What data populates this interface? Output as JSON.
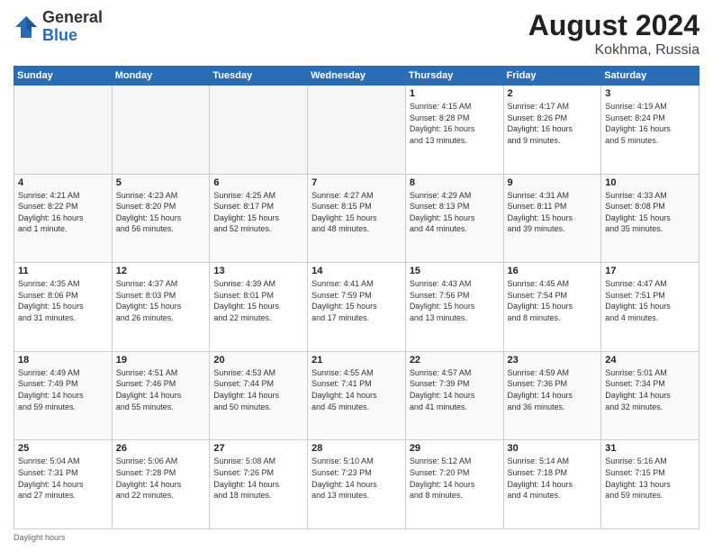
{
  "header": {
    "logo_general": "General",
    "logo_blue": "Blue",
    "month_year": "August 2024",
    "location": "Kokhma, Russia"
  },
  "footer": {
    "text": "Daylight hours"
  },
  "days_of_week": [
    "Sunday",
    "Monday",
    "Tuesday",
    "Wednesday",
    "Thursday",
    "Friday",
    "Saturday"
  ],
  "weeks": [
    [
      {
        "day": "",
        "info": ""
      },
      {
        "day": "",
        "info": ""
      },
      {
        "day": "",
        "info": ""
      },
      {
        "day": "",
        "info": ""
      },
      {
        "day": "1",
        "info": "Sunrise: 4:15 AM\nSunset: 8:28 PM\nDaylight: 16 hours\nand 13 minutes."
      },
      {
        "day": "2",
        "info": "Sunrise: 4:17 AM\nSunset: 8:26 PM\nDaylight: 16 hours\nand 9 minutes."
      },
      {
        "day": "3",
        "info": "Sunrise: 4:19 AM\nSunset: 8:24 PM\nDaylight: 16 hours\nand 5 minutes."
      }
    ],
    [
      {
        "day": "4",
        "info": "Sunrise: 4:21 AM\nSunset: 8:22 PM\nDaylight: 16 hours\nand 1 minute."
      },
      {
        "day": "5",
        "info": "Sunrise: 4:23 AM\nSunset: 8:20 PM\nDaylight: 15 hours\nand 56 minutes."
      },
      {
        "day": "6",
        "info": "Sunrise: 4:25 AM\nSunset: 8:17 PM\nDaylight: 15 hours\nand 52 minutes."
      },
      {
        "day": "7",
        "info": "Sunrise: 4:27 AM\nSunset: 8:15 PM\nDaylight: 15 hours\nand 48 minutes."
      },
      {
        "day": "8",
        "info": "Sunrise: 4:29 AM\nSunset: 8:13 PM\nDaylight: 15 hours\nand 44 minutes."
      },
      {
        "day": "9",
        "info": "Sunrise: 4:31 AM\nSunset: 8:11 PM\nDaylight: 15 hours\nand 39 minutes."
      },
      {
        "day": "10",
        "info": "Sunrise: 4:33 AM\nSunset: 8:08 PM\nDaylight: 15 hours\nand 35 minutes."
      }
    ],
    [
      {
        "day": "11",
        "info": "Sunrise: 4:35 AM\nSunset: 8:06 PM\nDaylight: 15 hours\nand 31 minutes."
      },
      {
        "day": "12",
        "info": "Sunrise: 4:37 AM\nSunset: 8:03 PM\nDaylight: 15 hours\nand 26 minutes."
      },
      {
        "day": "13",
        "info": "Sunrise: 4:39 AM\nSunset: 8:01 PM\nDaylight: 15 hours\nand 22 minutes."
      },
      {
        "day": "14",
        "info": "Sunrise: 4:41 AM\nSunset: 7:59 PM\nDaylight: 15 hours\nand 17 minutes."
      },
      {
        "day": "15",
        "info": "Sunrise: 4:43 AM\nSunset: 7:56 PM\nDaylight: 15 hours\nand 13 minutes."
      },
      {
        "day": "16",
        "info": "Sunrise: 4:45 AM\nSunset: 7:54 PM\nDaylight: 15 hours\nand 8 minutes."
      },
      {
        "day": "17",
        "info": "Sunrise: 4:47 AM\nSunset: 7:51 PM\nDaylight: 15 hours\nand 4 minutes."
      }
    ],
    [
      {
        "day": "18",
        "info": "Sunrise: 4:49 AM\nSunset: 7:49 PM\nDaylight: 14 hours\nand 59 minutes."
      },
      {
        "day": "19",
        "info": "Sunrise: 4:51 AM\nSunset: 7:46 PM\nDaylight: 14 hours\nand 55 minutes."
      },
      {
        "day": "20",
        "info": "Sunrise: 4:53 AM\nSunset: 7:44 PM\nDaylight: 14 hours\nand 50 minutes."
      },
      {
        "day": "21",
        "info": "Sunrise: 4:55 AM\nSunset: 7:41 PM\nDaylight: 14 hours\nand 45 minutes."
      },
      {
        "day": "22",
        "info": "Sunrise: 4:57 AM\nSunset: 7:39 PM\nDaylight: 14 hours\nand 41 minutes."
      },
      {
        "day": "23",
        "info": "Sunrise: 4:59 AM\nSunset: 7:36 PM\nDaylight: 14 hours\nand 36 minutes."
      },
      {
        "day": "24",
        "info": "Sunrise: 5:01 AM\nSunset: 7:34 PM\nDaylight: 14 hours\nand 32 minutes."
      }
    ],
    [
      {
        "day": "25",
        "info": "Sunrise: 5:04 AM\nSunset: 7:31 PM\nDaylight: 14 hours\nand 27 minutes."
      },
      {
        "day": "26",
        "info": "Sunrise: 5:06 AM\nSunset: 7:28 PM\nDaylight: 14 hours\nand 22 minutes."
      },
      {
        "day": "27",
        "info": "Sunrise: 5:08 AM\nSunset: 7:26 PM\nDaylight: 14 hours\nand 18 minutes."
      },
      {
        "day": "28",
        "info": "Sunrise: 5:10 AM\nSunset: 7:23 PM\nDaylight: 14 hours\nand 13 minutes."
      },
      {
        "day": "29",
        "info": "Sunrise: 5:12 AM\nSunset: 7:20 PM\nDaylight: 14 hours\nand 8 minutes."
      },
      {
        "day": "30",
        "info": "Sunrise: 5:14 AM\nSunset: 7:18 PM\nDaylight: 14 hours\nand 4 minutes."
      },
      {
        "day": "31",
        "info": "Sunrise: 5:16 AM\nSunset: 7:15 PM\nDaylight: 13 hours\nand 59 minutes."
      }
    ]
  ]
}
